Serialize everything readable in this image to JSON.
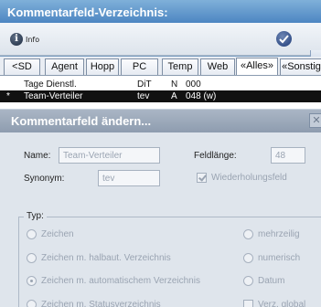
{
  "window": {
    "title": "Kommentarfeld-Verzeichnis:"
  },
  "toolbar": {
    "info_label": "Info"
  },
  "tabs": [
    "<SD",
    "Agent",
    "Hopp",
    "PC",
    "Temp",
    "Web",
    "«Alles»",
    "«Sonstig"
  ],
  "active_tab": "«Alles»",
  "list": {
    "rows": [
      {
        "marker": "",
        "name": "Tage Dienstl.",
        "code": "DiT",
        "type": "N",
        "number": "000",
        "selected": false
      },
      {
        "marker": "*",
        "name": "Team-Verteiler",
        "code": "tev",
        "type": "A",
        "number": "048 (w)",
        "selected": true
      }
    ]
  },
  "dialog": {
    "title": "Kommentarfeld ändern...",
    "name_label": "Name:",
    "name_value": "Team-Verteiler",
    "synonym_label": "Synonym:",
    "synonym_value": "tev",
    "length_label": "Feldlänge:",
    "length_value": "48",
    "repeat_label": "Wiederholungsfeld",
    "repeat_checked": true,
    "type_group_label": "Typ:",
    "type_left": [
      "Zeichen",
      "Zeichen m. halbaut. Verzeichnis",
      "Zeichen m. automatischem Verzeichnis",
      "Zeichen m. Statusverzeichnis"
    ],
    "type_right": [
      "mehrzeilig",
      "numerisch",
      "Datum"
    ],
    "global_label": "Verz. global",
    "selected_type": "Zeichen m. automatischem Verzeichnis"
  },
  "colors": {
    "title_bar": "#4d86c2",
    "dialog_title": "#8e9caf",
    "selected_row": "#111111",
    "disabled_text": "#9aa4b2"
  }
}
